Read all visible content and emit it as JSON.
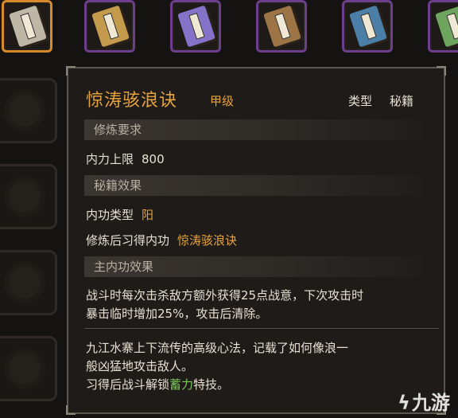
{
  "inventory": {
    "slots": [
      {
        "icon": "book-icon-gold",
        "color": "#bfb7a6",
        "selected": true
      },
      {
        "icon": "book-icon-tan",
        "color": "#c49a4d",
        "selected": false
      },
      {
        "icon": "book-icon-purple",
        "color": "#8473c9",
        "selected": false
      },
      {
        "icon": "book-icon-brown",
        "color": "#9c7445",
        "selected": false
      },
      {
        "icon": "book-icon-blue",
        "color": "#4c7fa8",
        "selected": false
      },
      {
        "icon": "book-icon-green",
        "color": "#6da45e",
        "selected": false
      }
    ]
  },
  "tooltip": {
    "name": "惊涛骇浪诀",
    "grade": "甲级",
    "type_label": "类型",
    "type_value": "秘籍",
    "sections": {
      "requirements_title": "修炼要求",
      "effects_title": "秘籍效果",
      "passive_title": "主内功效果"
    },
    "requirements": {
      "neili_label": "内力上限",
      "neili_value": "800"
    },
    "effects": {
      "neigong_type_label": "内功类型",
      "neigong_type_value": "阳",
      "learned_label": "修炼后习得内功",
      "learned_value": "惊涛骇浪诀"
    },
    "passive": {
      "line1": "战斗时每次击杀敌方额外获得25点战意，下次攻击时",
      "line2": "暴击临时增加25%，攻击后清除。"
    },
    "description": {
      "line1": "九江水寨上下流传的高级心法，记载了如何像浪一",
      "line2": "般凶猛地攻击敌人。",
      "line3_prefix": "习得后战斗解锁",
      "line3_skill": "蓄力",
      "line3_suffix": "特技。"
    }
  },
  "watermark": "九游"
}
